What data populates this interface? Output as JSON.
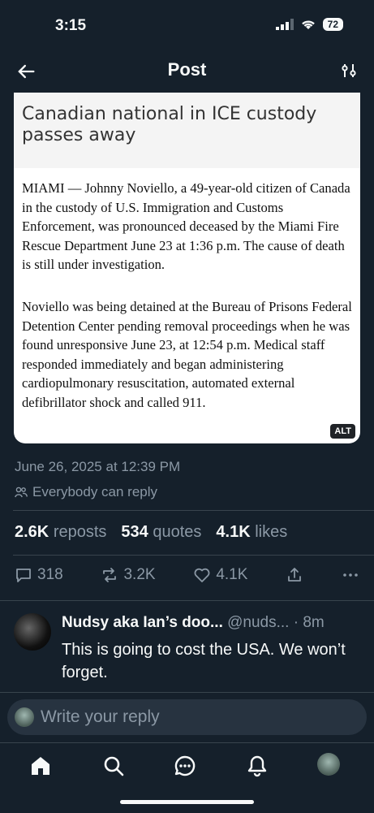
{
  "status_bar": {
    "time": "3:15",
    "battery": "72"
  },
  "header": {
    "title": "Post"
  },
  "article": {
    "headline": "Canadian national in ICE custody passes away",
    "paragraph1": "MIAMI — Johnny Noviello, a 49-year-old citizen of Canada in the custody of U.S. Immigration and Customs Enforcement, was pronounced deceased by the Miami Fire Rescue Department June 23 at 1:36 p.m. The cause of death is still under investigation.",
    "paragraph2": "Noviello was being detained at the Bureau of Prisons Federal Detention Center pending removal proceedings when he was found unresponsive June 23, at 12:54 p.m. Medical staff responded immediately and began administering cardiopulmonary resuscitation, automated external defibrillator shock and called 911.",
    "alt_badge": "ALT"
  },
  "meta": {
    "timestamp": "June 26, 2025 at 12:39 PM",
    "reply_scope": "Everybody can reply"
  },
  "stats": {
    "reposts_count": "2.6K",
    "reposts_label": "reposts",
    "quotes_count": "534",
    "quotes_label": "quotes",
    "likes_count": "4.1K",
    "likes_label": "likes"
  },
  "actions": {
    "replies": "318",
    "reposts": "3.2K",
    "likes": "4.1K"
  },
  "reply": {
    "name": "Nudsy aka Ian’s doo...",
    "handle": "@nuds...",
    "time": "· 8m",
    "text": "This is going to cost the USA. We won’t forget."
  },
  "compose": {
    "placeholder": "Write your reply"
  },
  "tabs": [
    "home-icon",
    "search-icon",
    "messages-icon",
    "notifications-icon",
    "profile-avatar"
  ]
}
